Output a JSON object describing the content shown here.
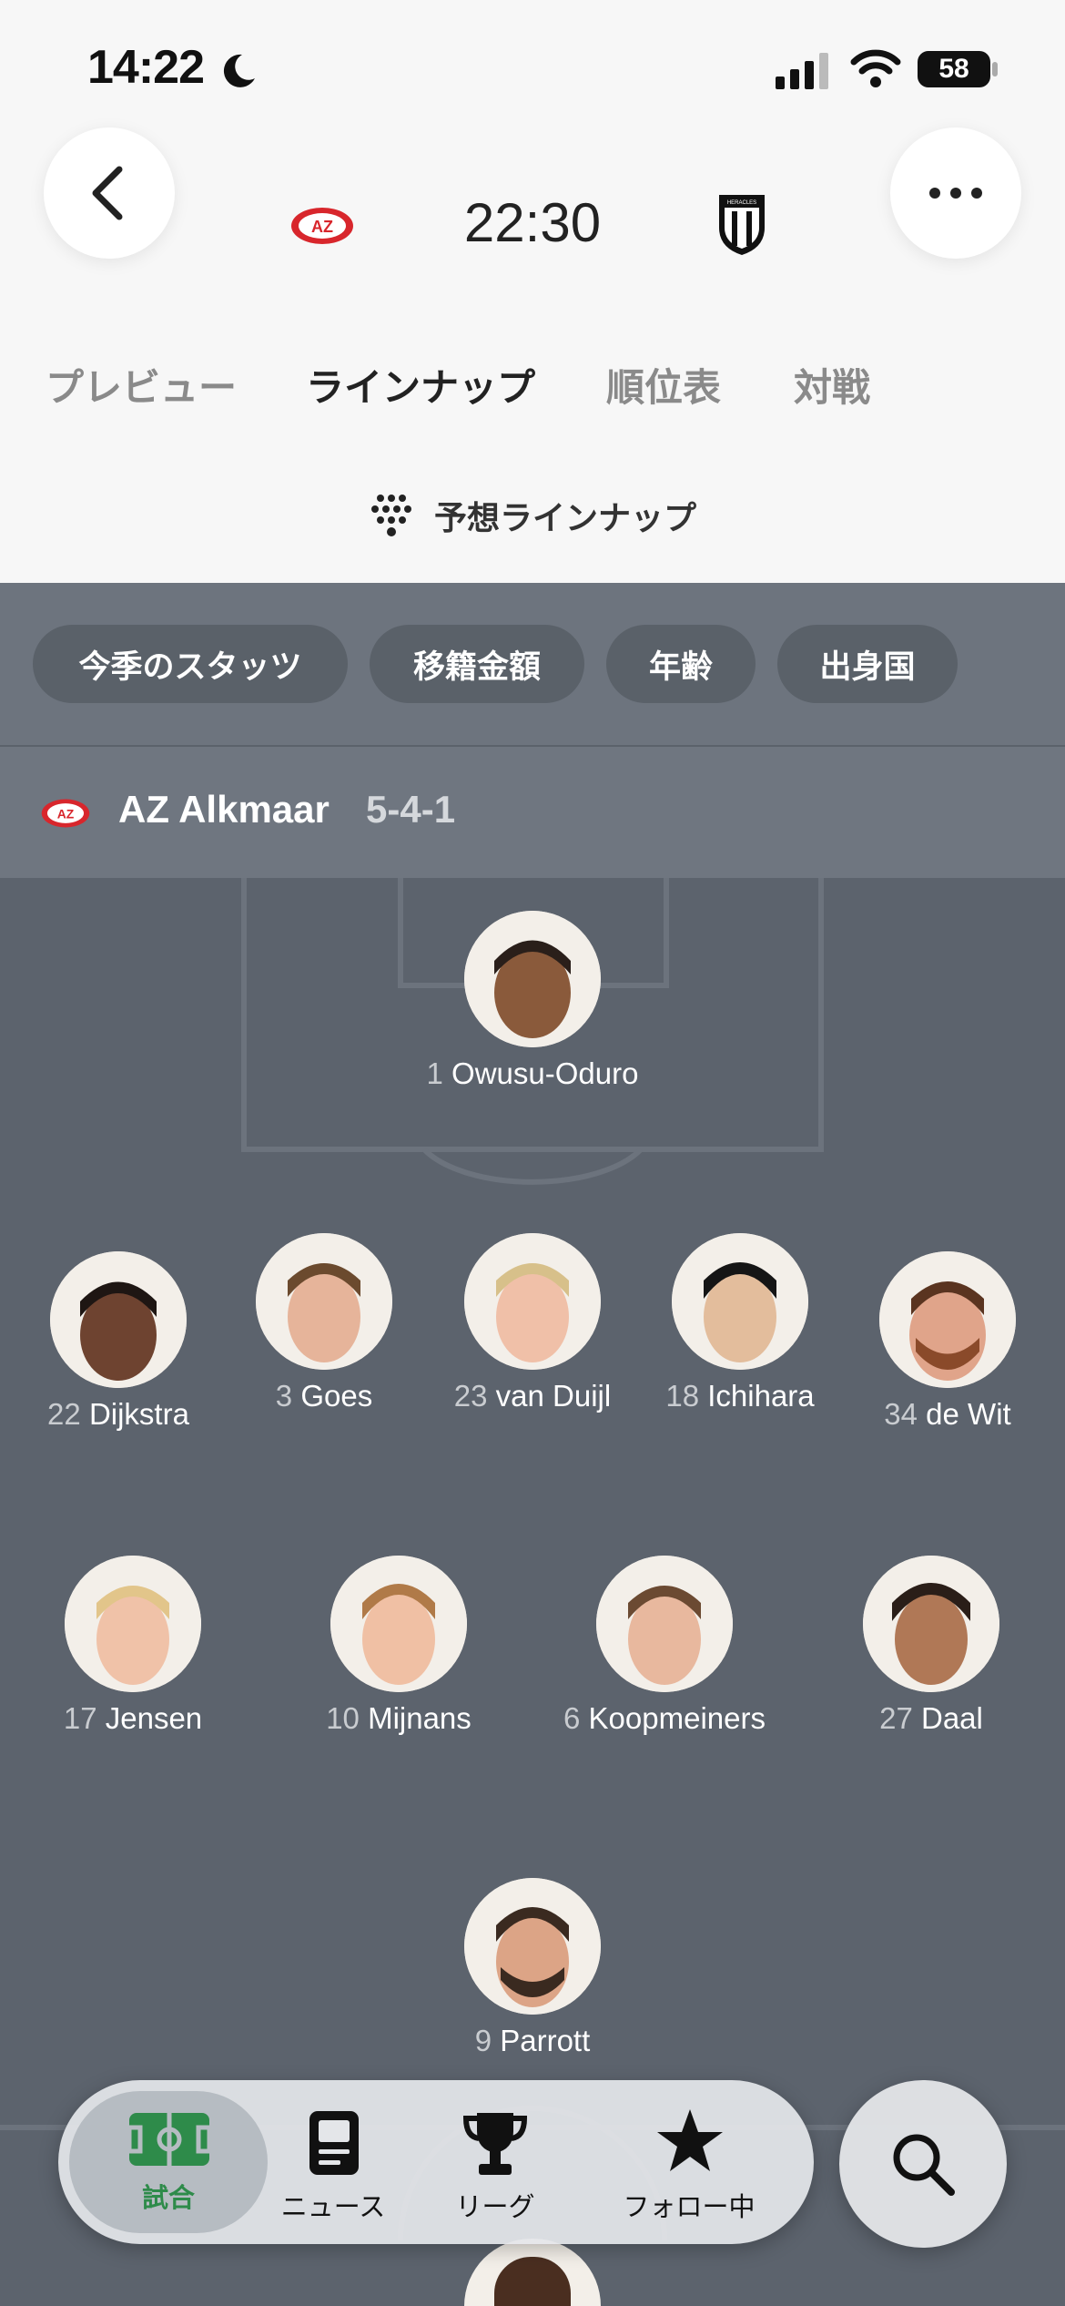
{
  "status_bar": {
    "time": "14:22",
    "battery": "58"
  },
  "match": {
    "kickoff": "22:30",
    "home_team_badge": "AZ",
    "away_team_badge": "HERACLES"
  },
  "tabs": [
    {
      "label": "プレビュー"
    },
    {
      "label": "ラインナップ"
    },
    {
      "label": "順位表"
    },
    {
      "label": "対戦"
    }
  ],
  "predicted_label": "予想ラインナップ",
  "filters": [
    {
      "label": "今季のスタッツ"
    },
    {
      "label": "移籍金額"
    },
    {
      "label": "年齢"
    },
    {
      "label": "出身国"
    }
  ],
  "team": {
    "name": "AZ Alkmaar",
    "formation": "5-4-1"
  },
  "players": [
    {
      "number": "1",
      "name": "Owusu-Oduro"
    },
    {
      "number": "22",
      "name": "Dijkstra"
    },
    {
      "number": "3",
      "name": "Goes"
    },
    {
      "number": "23",
      "name": "van Duijl"
    },
    {
      "number": "18",
      "name": "Ichihara"
    },
    {
      "number": "34",
      "name": "de Wit"
    },
    {
      "number": "17",
      "name": "Jensen"
    },
    {
      "number": "10",
      "name": "Mijnans"
    },
    {
      "number": "6",
      "name": "Koopmeiners"
    },
    {
      "number": "27",
      "name": "Daal"
    },
    {
      "number": "9",
      "name": "Parrott"
    }
  ],
  "nav": [
    {
      "label": "試合",
      "icon": "pitch-icon"
    },
    {
      "label": "ニュース",
      "icon": "news-icon"
    },
    {
      "label": "リーグ",
      "icon": "trophy-icon"
    },
    {
      "label": "フォロー中",
      "icon": "star-icon"
    }
  ],
  "colors": {
    "active_green": "#2e8b4a",
    "header_bg": "#f7f7f7",
    "pitch_bg": "#5c636d"
  }
}
